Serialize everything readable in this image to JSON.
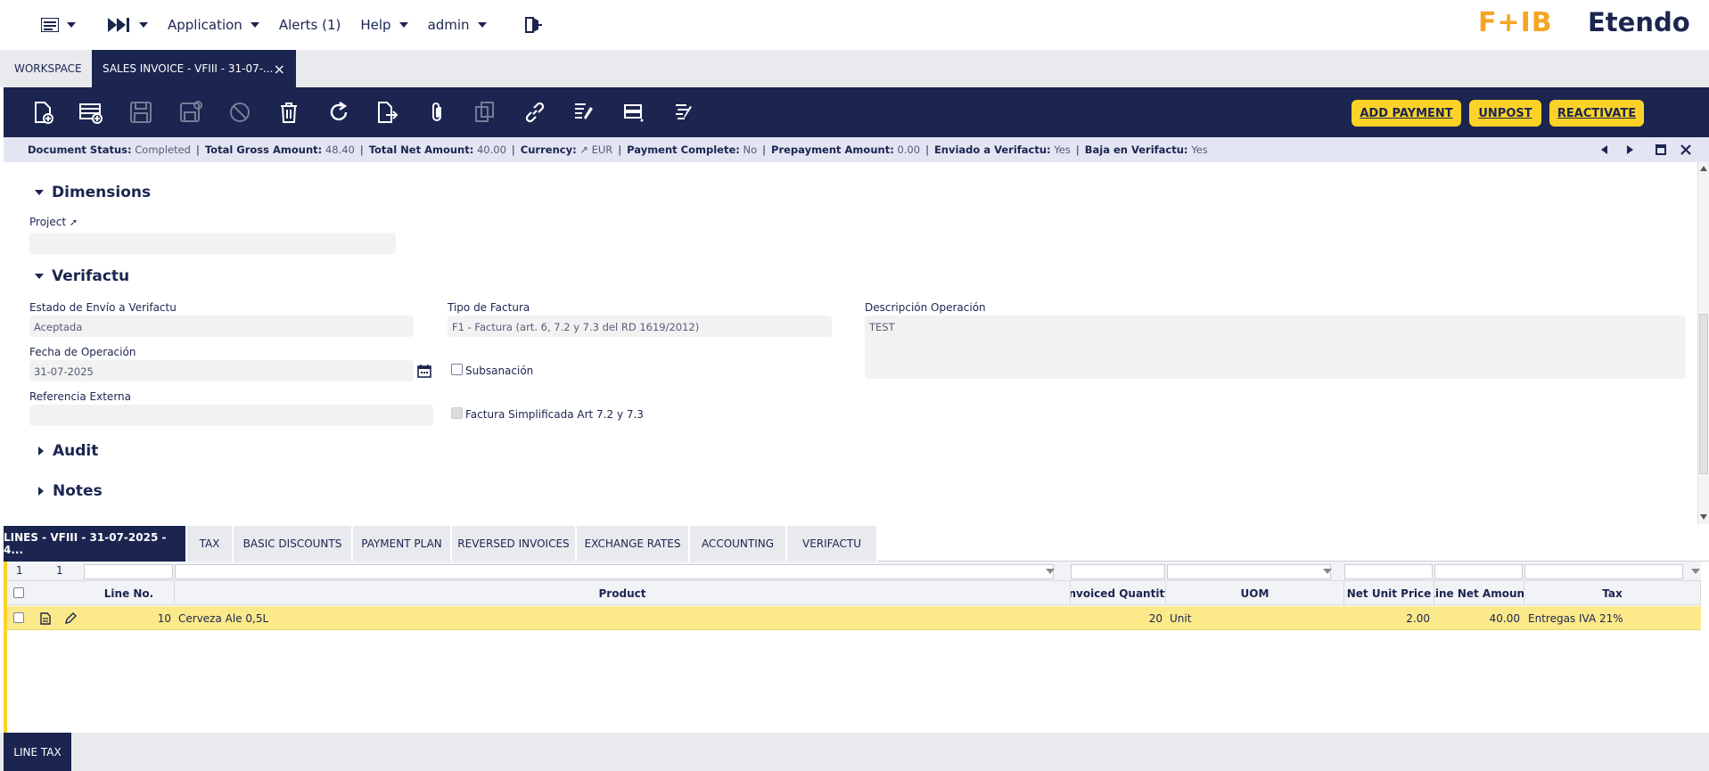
{
  "topnav": {
    "application": "Application",
    "alerts": "Alerts (1)",
    "help": "Help",
    "user": "admin"
  },
  "brand": {
    "logo1": "F+IB",
    "logo2": "Etendo",
    "accent": "#f5a623"
  },
  "tabs": {
    "workspace": "WORKSPACE",
    "active": "SALES INVOICE - VFIII - 31-07-...",
    "close": "×"
  },
  "actions": {
    "add_payment": "ADD PAYMENT",
    "unpost": "UNPOST",
    "reactivate": "REACTIVATE"
  },
  "status": [
    {
      "label": "Document Status:",
      "value": "Completed"
    },
    {
      "label": "Total Gross Amount:",
      "value": "48.40"
    },
    {
      "label": "Total Net Amount:",
      "value": "40.00"
    },
    {
      "label": "Currency:",
      "value": "↗ EUR"
    },
    {
      "label": "Payment Complete:",
      "value": "No"
    },
    {
      "label": "Prepayment Amount:",
      "value": "0.00"
    },
    {
      "label": "Enviado a Verifactu:",
      "value": "Yes"
    },
    {
      "label": "Baja en Verifactu:",
      "value": "Yes"
    }
  ],
  "form": {
    "dimensions": "Dimensions",
    "project_label": "Project",
    "project_value": "",
    "verifactu": "Verifactu",
    "estado_label": "Estado de Envío a Verifactu",
    "estado_value": "Aceptada",
    "tipo_label": "Tipo de Factura",
    "tipo_value": "F1 - Factura (art. 6, 7.2 y 7.3 del RD 1619/2012)",
    "desc_label": "Descripción Operación",
    "desc_value": "TEST",
    "fecha_label": "Fecha de Operación",
    "fecha_value": "31-07-2025",
    "subsanacion": "Subsanación",
    "ref_label": "Referencia Externa",
    "ref_value": "",
    "simplificada": "Factura Simplificada Art 7.2 y 7.3",
    "audit": "Audit",
    "notes": "Notes"
  },
  "subtabs": [
    "LINES - VFIII - 31-07-2025 - 4...",
    "TAX",
    "BASIC DISCOUNTS",
    "PAYMENT PLAN",
    "REVERSED INVOICES",
    "EXCHANGE RATES",
    "ACCOUNTING",
    "VERIFACTU"
  ],
  "grid": {
    "count_a": "1",
    "count_b": "1",
    "headers": {
      "line_no": "Line No.",
      "product": "Product",
      "qty": "Invoiced Quantity",
      "uom": "UOM",
      "price": "Net Unit Price",
      "amount": "Line Net Amount",
      "tax": "Tax"
    },
    "rows": [
      {
        "line_no": "10",
        "product": "Cerveza Ale 0,5L",
        "qty": "20",
        "uom": "Unit",
        "price": "2.00",
        "amount": "40.00",
        "tax": "Entregas IVA 21%"
      }
    ]
  },
  "bottom_tab": "LINE TAX"
}
